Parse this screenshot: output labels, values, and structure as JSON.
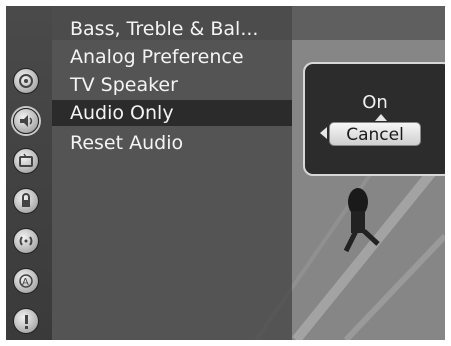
{
  "menu": {
    "items": [
      {
        "label": "Bass, Treble & Bal..."
      },
      {
        "label": "Analog Preference"
      },
      {
        "label": "TV Speaker"
      },
      {
        "label": "Audio Only",
        "selected": true
      },
      {
        "label": "Reset Audio"
      }
    ]
  },
  "popup": {
    "value_label": "On",
    "cancel_label": "Cancel"
  },
  "icons": [
    {
      "name": "settings-icon"
    },
    {
      "name": "audio-icon",
      "active": true
    },
    {
      "name": "tv-icon"
    },
    {
      "name": "lock-icon"
    },
    {
      "name": "channel-icon"
    },
    {
      "name": "feature-icon"
    },
    {
      "name": "help-icon"
    }
  ]
}
